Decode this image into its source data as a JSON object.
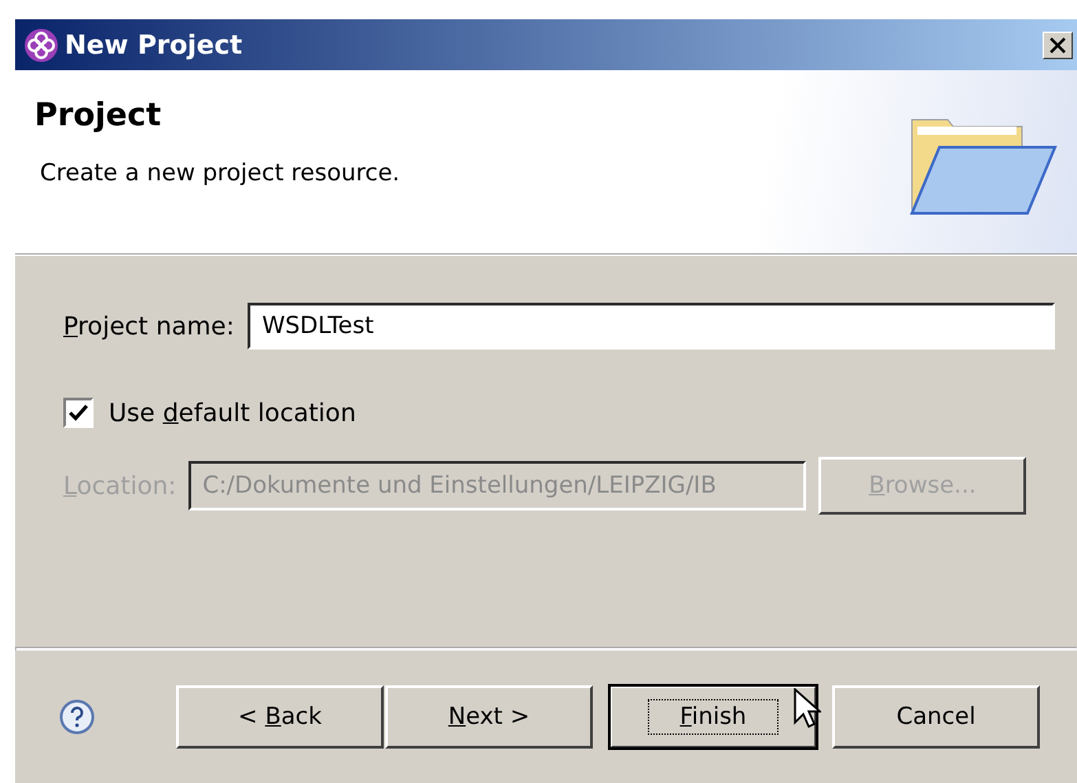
{
  "window": {
    "title": "New Project"
  },
  "header": {
    "title": "Project",
    "description": "Create a new project resource."
  },
  "project_name": {
    "label": [
      {
        "text": "P",
        "underline": true
      },
      {
        "text": "roject name:",
        "underline": false
      }
    ],
    "value": "WSDLTest"
  },
  "default_location": {
    "label": [
      {
        "text": "Use ",
        "underline": false
      },
      {
        "text": "d",
        "underline": true
      },
      {
        "text": "efault location",
        "underline": false
      }
    ],
    "checked": true
  },
  "location": {
    "label": [
      {
        "text": "L",
        "underline": true
      },
      {
        "text": "ocation:",
        "underline": false
      }
    ],
    "value": "C:/Dokumente und Einstellungen/LEIPZIG/IB",
    "disabled": true
  },
  "browse_button": {
    "label": [
      {
        "text": "B",
        "underline": true
      },
      {
        "text": "rowse...",
        "underline": false
      }
    ],
    "disabled": true
  },
  "buttons": [
    {
      "label": [
        {
          "text": "< ",
          "underline": false
        },
        {
          "text": "B",
          "underline": true
        },
        {
          "text": "ack",
          "underline": false
        }
      ],
      "default": false
    },
    {
      "label": [
        {
          "text": "N",
          "underline": true
        },
        {
          "text": "ext >",
          "underline": false
        }
      ],
      "default": false
    },
    {
      "label": [
        {
          "text": "F",
          "underline": true
        },
        {
          "text": "inish",
          "underline": false
        }
      ],
      "default": true
    },
    {
      "label": [
        {
          "text": "Cancel",
          "underline": false
        }
      ],
      "default": false
    }
  ]
}
